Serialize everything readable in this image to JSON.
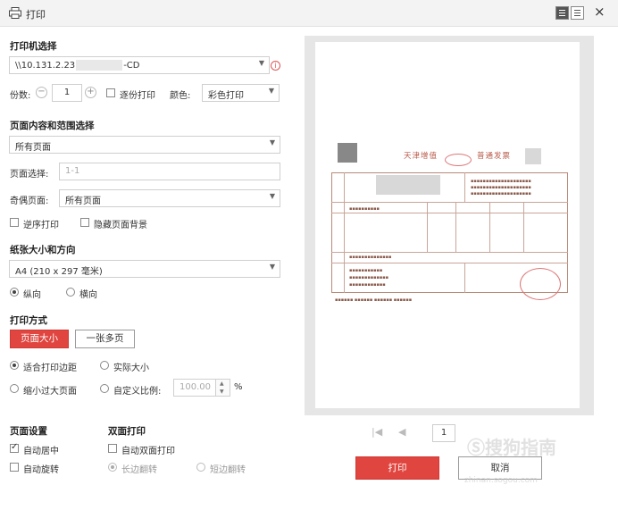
{
  "titlebar": {
    "title": "打印",
    "printer_icon": "printer-icon",
    "close": "×"
  },
  "printer": {
    "section_title": "打印机选择",
    "name_prefix": "\\\\10.131.2.23",
    "name_suffix": "-CD"
  },
  "copies": {
    "label": "份数:",
    "minus": "−",
    "value": "1",
    "plus": "+",
    "collate_label": "逐份打印",
    "collate_checked": false,
    "color_label": "颜色:",
    "color_value": "彩色打印"
  },
  "range": {
    "section_title": "页面内容和范围选择",
    "content_value": "所有页面",
    "page_select_label": "页面选择:",
    "page_select_placeholder": "1-1",
    "odd_even_label": "奇偶页面:",
    "odd_even_value": "所有页面",
    "reverse_label": "逆序打印",
    "reverse_checked": false,
    "hide_bg_label": "隐藏页面背景",
    "hide_bg_checked": false
  },
  "paper": {
    "section_title": "纸张大小和方向",
    "size_value": "A4 (210 x 297 毫米)",
    "portrait_label": "纵向",
    "landscape_label": "横向",
    "orientation": "portrait"
  },
  "method": {
    "section_title": "打印方式",
    "tab_page_size": "页面大小",
    "tab_multi": "一张多页",
    "active_tab": "page_size",
    "fit_margin_label": "适合打印边距",
    "actual_size_label": "实际大小",
    "shrink_label": "缩小过大页面",
    "custom_label": "自定义比例:",
    "custom_value": "100.00",
    "percent": "%",
    "selected": "fit_margin"
  },
  "page_settings": {
    "section_title": "页面设置",
    "auto_center_label": "自动居中",
    "auto_center_checked": true,
    "auto_rotate_label": "自动旋转",
    "auto_rotate_checked": false
  },
  "duplex": {
    "section_title": "双面打印",
    "auto_duplex_label": "自动双面打印",
    "auto_duplex_checked": false,
    "long_edge_label": "长边翻转",
    "short_edge_label": "短边翻转",
    "flip": "long_edge"
  },
  "preview": {
    "invoice_title_a": "天津增值",
    "invoice_title_b": "普通发票",
    "page_number": "1"
  },
  "actions": {
    "print_label": "打印",
    "cancel_label": "取消"
  },
  "watermark": {
    "text": "搜狗指南",
    "sub": "zhinan.sogou.com"
  },
  "colors": {
    "accent": "#e0453f",
    "border": "#cfcfcf",
    "preview_bg": "#e6e6e6"
  }
}
